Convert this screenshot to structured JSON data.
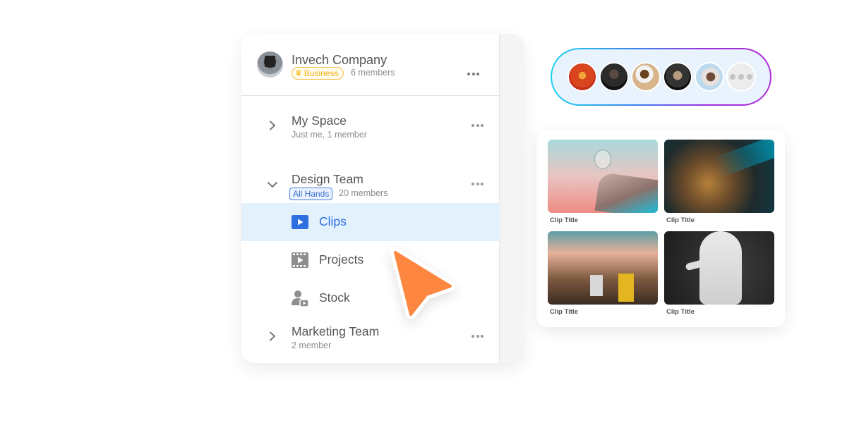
{
  "organization": {
    "name": "Invech Company",
    "plan_badge": "Business",
    "plan_icon": "crown-icon",
    "members": "6 members"
  },
  "spaces": [
    {
      "title": "My Space",
      "subtitle": "Just me, 1 member",
      "expanded": false
    },
    {
      "title": "Design Team",
      "badge": "All Hands",
      "subtitle": "20 members",
      "expanded": true,
      "items": [
        {
          "label": "Clips",
          "icon": "play-icon",
          "active": true
        },
        {
          "label": "Projects",
          "icon": "film-icon",
          "active": false
        },
        {
          "label": "Stock",
          "icon": "user-video-icon",
          "active": false
        }
      ]
    },
    {
      "title": "Marketing Team",
      "subtitle": "2 member",
      "expanded": false
    }
  ],
  "members_strip": {
    "avatars": [
      "member-1",
      "member-2",
      "member-3",
      "member-4",
      "member-5"
    ],
    "more_icon": "more-icon"
  },
  "clips": [
    {
      "title": "Clip Title"
    },
    {
      "title": "Clip Title"
    },
    {
      "title": "Clip Title"
    },
    {
      "title": "Clip Title"
    }
  ],
  "colors": {
    "accent_blue": "#2f6fe0",
    "active_row_bg": "#e3f1fd",
    "business_gold": "#f2b21d",
    "cursor_orange": "#fd8640"
  }
}
